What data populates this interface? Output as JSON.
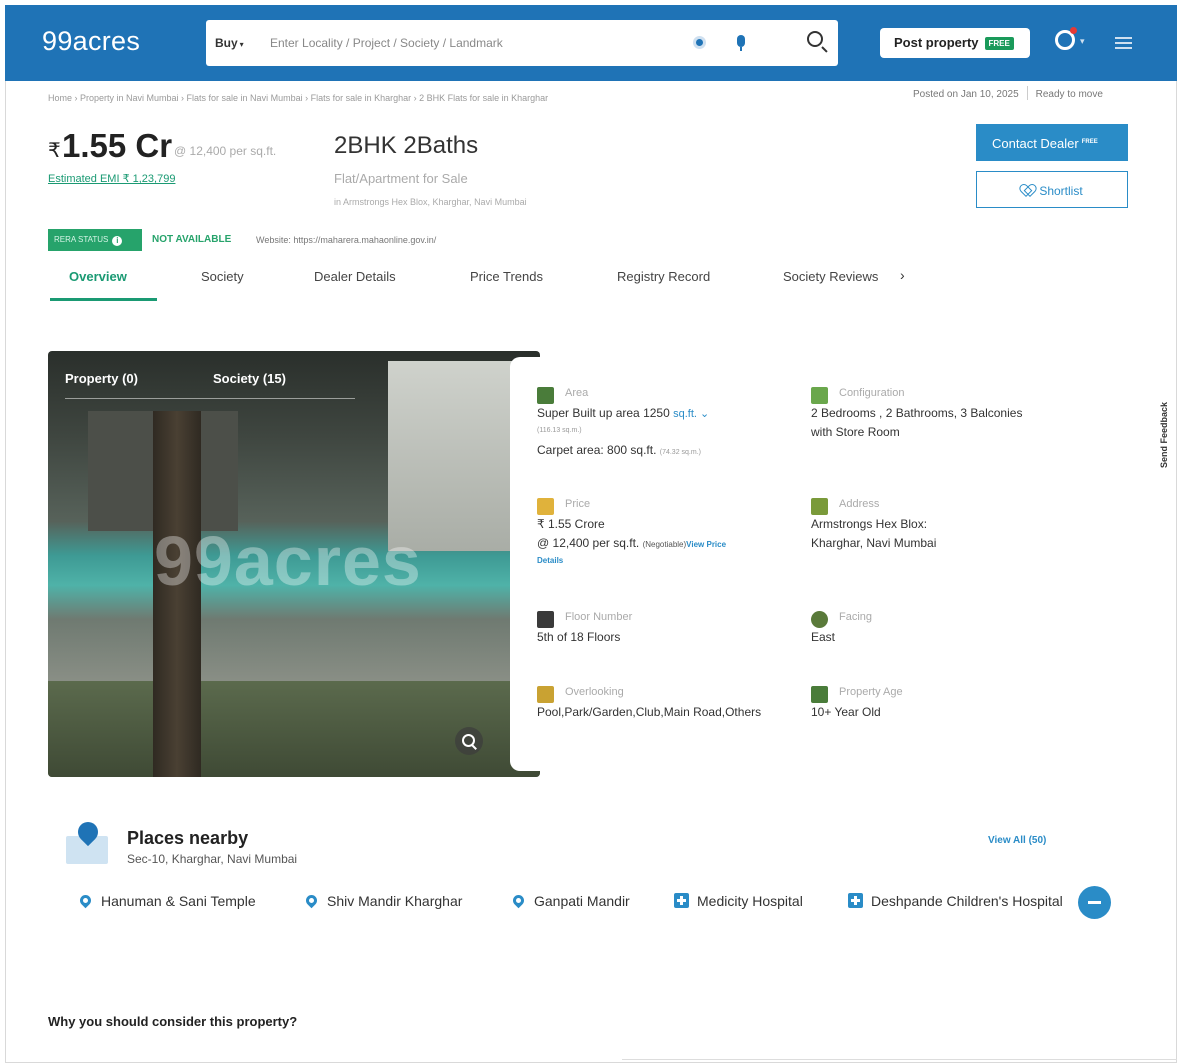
{
  "header": {
    "logo": "99acres",
    "search": {
      "type": "Buy",
      "placeholder": "Enter Locality / Project / Society / Landmark"
    },
    "post_property": "Post property",
    "post_badge": "FREE",
    "brand_color": "#1f73b6"
  },
  "breadcrumb": "Home › Property in Navi Mumbai › Flats for sale in Navi Mumbai › Flats for sale in Kharghar › 2 BHK Flats for sale in Kharghar",
  "posted": {
    "date": "Posted on Jan 10, 2025",
    "status": "Ready to move"
  },
  "listing": {
    "rupee": "₹",
    "price": "1.55 Cr",
    "price_per_sqft": "@ 12,400 per sq.ft.",
    "emi": "Estimated EMI ₹ 1,23,799",
    "title": "2BHK 2Baths",
    "subtitle": "Flat/Apartment for Sale",
    "location": "in Armstrongs Hex Blox, Kharghar, Navi Mumbai",
    "contact_button": "Contact Dealer",
    "contact_badge": "FREE",
    "shortlist_button": "Shortlist"
  },
  "rera": {
    "badge": "RERA STATUS",
    "status": "NOT AVAILABLE",
    "website": "Website: https://maharera.mahaonline.gov.in/"
  },
  "tabs": [
    {
      "label": "Overview"
    },
    {
      "label": "Society"
    },
    {
      "label": "Dealer Details"
    },
    {
      "label": "Price Trends"
    },
    {
      "label": "Registry Record"
    },
    {
      "label": "Society Reviews"
    }
  ],
  "gallery": {
    "tabs": [
      {
        "label": "Property (0)"
      },
      {
        "label": "Society (15)"
      }
    ],
    "watermark": "99acres"
  },
  "details": {
    "area": {
      "label": "Area",
      "line1": "Super Built up area 1250",
      "unit": "sq.ft.",
      "line1_small": "(116.13 sq.m.)",
      "line2": "Carpet area: 800 sq.ft.",
      "line2_small": "(74.32 sq.m.)"
    },
    "configuration": {
      "label": "Configuration",
      "line1": "2 Bedrooms , 2 Bathrooms, 3 Balconies",
      "line2": "with Store Room"
    },
    "price": {
      "label": "Price",
      "line1": "₹ 1.55 Crore",
      "line2": "@ 12,400 per sq.ft.",
      "negotiable": "(Negotiable)",
      "link_a": "View Price",
      "link_b": "Details"
    },
    "address": {
      "label": "Address",
      "line1": "Armstrongs Hex Blox:",
      "line2": "Kharghar, Navi Mumbai"
    },
    "floor": {
      "label": "Floor Number",
      "value": "5th  of 18 Floors"
    },
    "facing": {
      "label": "Facing",
      "value": "East"
    },
    "overlooking": {
      "label": "Overlooking",
      "value": "Pool,Park/Garden,Club,Main Road,Others"
    },
    "age": {
      "label": "Property Age",
      "value": "10+ Year Old"
    }
  },
  "places": {
    "title": "Places nearby",
    "subtitle": "Sec-10, Kharghar, Navi Mumbai",
    "view_all": "View All (50)",
    "items": [
      {
        "label": "Hanuman & Sani Temple",
        "icon": "pin-icon"
      },
      {
        "label": "Shiv Mandir Kharghar",
        "icon": "pin-icon"
      },
      {
        "label": "Ganpati Mandir",
        "icon": "pin-icon"
      },
      {
        "label": "Medicity Hospital",
        "icon": "hospital-icon"
      },
      {
        "label": "Deshpande Children's Hospital",
        "icon": "hospital-icon"
      }
    ]
  },
  "consider_heading": "Why you should consider this property?",
  "feedback": "Send Feedback"
}
